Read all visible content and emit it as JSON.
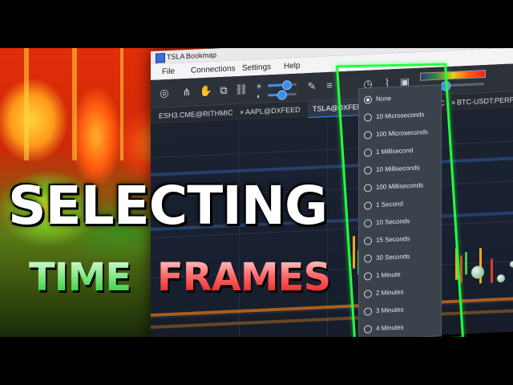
{
  "window": {
    "ticker": "TSLA",
    "app_name": "Bookmap"
  },
  "menu": {
    "items": [
      "File",
      "Connections",
      "Settings",
      "Help"
    ]
  },
  "tabs": [
    {
      "label": "ESH3.CME@RITHMIC",
      "close": "×"
    },
    {
      "label": "AAPL@DXFEED",
      "close": "×"
    },
    {
      "label": "TSLA@DXFEED",
      "close": "×"
    },
    {
      "label": "MIC",
      "close": "×"
    },
    {
      "label": "BTC-USDT:PERP",
      "close": ""
    }
  ],
  "dropdown": {
    "selected": "None",
    "options": [
      "None",
      "10 Microseconds",
      "100 Microseconds",
      "1 Millisecond",
      "10 Milliseconds",
      "100 Milliseconds",
      "1 Second",
      "10 Seconds",
      "15 Seconds",
      "30 Seconds",
      "1 Minute",
      "2 Minutes",
      "3 Minutes",
      "4 Minutes"
    ]
  },
  "headline": {
    "line1": "SELECTING",
    "line2_a": "TIME",
    "line2_b": "FRAMES"
  },
  "colors": {
    "highlight_box": "#23ff3f",
    "accent": "#3b8ef0",
    "headline_green": "#13c624",
    "headline_red": "#e21010"
  }
}
